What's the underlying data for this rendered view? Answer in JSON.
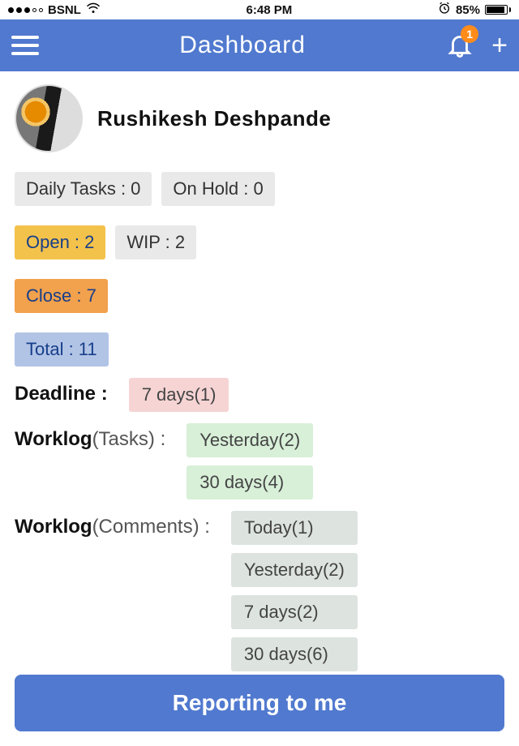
{
  "status": {
    "carrier": "BSNL",
    "time": "6:48 PM",
    "battery_pct": "85%"
  },
  "header": {
    "title": "Dashboard",
    "notification_count": "1"
  },
  "user": {
    "name": "Rushikesh Deshpande"
  },
  "counters": {
    "daily_tasks": "Daily Tasks : 0",
    "on_hold": "On Hold : 0",
    "open": "Open : 2",
    "wip": "WIP : 2",
    "close": "Close : 7",
    "total": "Total : 11"
  },
  "deadline": {
    "label": "Deadline :",
    "seven": "7 days(1)"
  },
  "worklog_tasks": {
    "label_main": "Worklog",
    "label_sub": "(Tasks) :",
    "yesterday": "Yesterday(2)",
    "thirty": "30 days(4)"
  },
  "worklog_comments": {
    "label_main": "Worklog",
    "label_sub": "(Comments) :",
    "today": "Today(1)",
    "yesterday": "Yesterday(2)",
    "seven": "7 days(2)",
    "thirty": "30 days(6)"
  },
  "footer": {
    "button": "Reporting to me"
  }
}
